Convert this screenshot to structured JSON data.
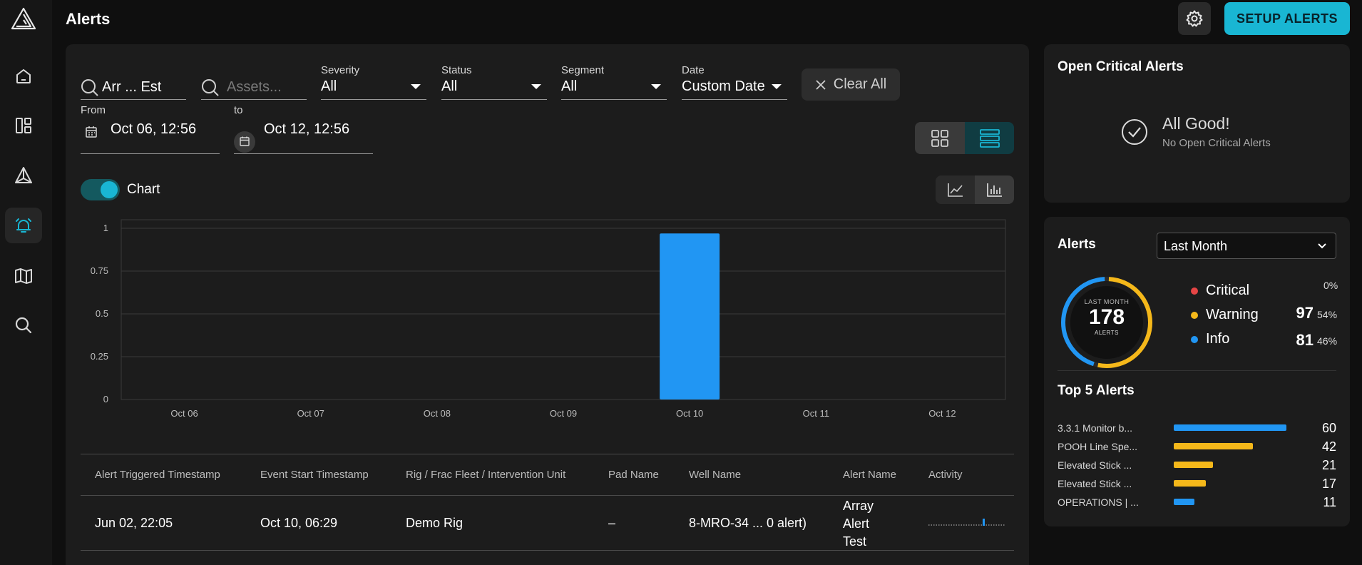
{
  "header": {
    "title": "Alerts",
    "setup_label": "SETUP ALERTS"
  },
  "colors": {
    "accent": "#19b6d3",
    "critical": "#e64545",
    "warning": "#f5b81a",
    "info": "#2196f3"
  },
  "nav": {
    "items": [
      "home-icon",
      "dashboard-icon",
      "rig-icon",
      "alarm-icon",
      "map-icon",
      "search-icon"
    ],
    "active": "alarm-icon"
  },
  "filters": {
    "search_value": "Arr ... Est",
    "assets_placeholder": "Assets...",
    "severity": {
      "label": "Severity",
      "value": "All"
    },
    "status": {
      "label": "Status",
      "value": "All"
    },
    "segment": {
      "label": "Segment",
      "value": "All"
    },
    "date": {
      "label": "Date",
      "value": "Custom Date"
    },
    "clear_label": "Clear All",
    "from_label": "From",
    "from_value": "Oct 06, 12:56",
    "to_label": "to",
    "to_value": "Oct 12, 12:56"
  },
  "chart_toggle": {
    "label": "Chart",
    "on": true
  },
  "chart_data": {
    "type": "bar",
    "categories": [
      "Oct 06",
      "Oct 07",
      "Oct 08",
      "Oct 09",
      "Oct 10",
      "Oct 11",
      "Oct 12"
    ],
    "values": [
      0,
      0,
      0,
      0,
      0.97,
      0,
      0
    ],
    "yticks": [
      "0",
      "0.25",
      "0.5",
      "0.75",
      "1"
    ],
    "ylim": [
      0,
      1.05
    ],
    "grid": true,
    "bar_color": "#2196f3"
  },
  "table": {
    "columns": [
      "Alert Triggered Timestamp",
      "Event Start Timestamp",
      "Rig / Frac Fleet / Intervention Unit",
      "Pad Name",
      "Well Name",
      "Alert Name",
      "Activity"
    ],
    "rows": [
      {
        "triggered": "Jun 02, 22:05",
        "event_start": "Oct 10, 06:29",
        "rig": "Demo Rig",
        "pad": "–",
        "well": "8-MRO-34 ... 0 alert)",
        "alert_name": [
          "Array",
          "Alert",
          "Test"
        ]
      }
    ]
  },
  "open_critical": {
    "title": "Open Critical Alerts",
    "status": "All Good!",
    "message": "No Open Critical Alerts"
  },
  "alerts_summary": {
    "title": "Alerts",
    "period": "Last Month",
    "ring_caption_top": "LAST MONTH",
    "total": "178",
    "ring_caption_bottom": "ALERTS",
    "breakdown": [
      {
        "name": "Critical",
        "count": "",
        "pct": "0%",
        "color": "#e64545"
      },
      {
        "name": "Warning",
        "count": "97",
        "pct": "54%",
        "color": "#f5b81a"
      },
      {
        "name": "Info",
        "count": "81",
        "pct": "46%",
        "color": "#2196f3"
      }
    ]
  },
  "top5": {
    "title": "Top 5 Alerts",
    "items": [
      {
        "name": "3.3.1 Monitor b...",
        "value": 60,
        "color": "#2196f3"
      },
      {
        "name": "POOH Line Spe...",
        "value": 42,
        "color": "#f5b81a"
      },
      {
        "name": "Elevated Stick ...",
        "value": 21,
        "color": "#f5b81a"
      },
      {
        "name": "Elevated Stick ...",
        "value": 17,
        "color": "#f5b81a"
      },
      {
        "name": "OPERATIONS | ...",
        "value": 11,
        "color": "#2196f3"
      }
    ]
  }
}
